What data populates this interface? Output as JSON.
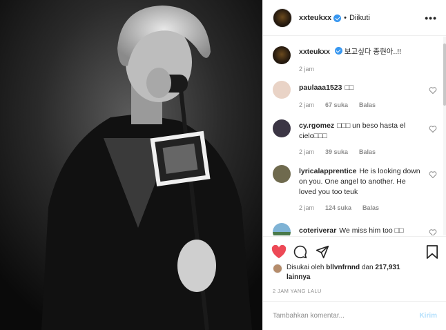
{
  "header": {
    "username": "xxteukxx",
    "dot": "•",
    "follow_label": "Diikuti",
    "more_label": "•••"
  },
  "caption": {
    "username": "xxteukxx",
    "text": "보고싶다 종현아..!!",
    "time": "2 jam"
  },
  "comments": [
    {
      "username": "paulaaa1523",
      "text": "□□",
      "time": "2 jam",
      "likes": "67 suka",
      "reply": "Balas"
    },
    {
      "username": "cy.rgomez",
      "text": "□□□ un beso hasta el cielo□□□",
      "time": "2 jam",
      "likes": "39 suka",
      "reply": "Balas"
    },
    {
      "username": "lyricalapprentice",
      "text": "He is looking down on you. One angel to another. He loved you too teuk",
      "time": "2 jam",
      "likes": "124 suka",
      "reply": "Balas"
    },
    {
      "username": "coteriverar",
      "text": "We miss him too □□"
    }
  ],
  "likes": {
    "prefix": "Disukai oleh",
    "user": "bllvnfrnnd",
    "and": "dan",
    "count": "217,931 lainnya"
  },
  "timestamp": "2 JAM YANG LALU",
  "add_comment": {
    "placeholder": "Tambahkan komentar...",
    "post_label": "Kirim"
  },
  "colors": {
    "like_red": "#ed4956",
    "verified_blue": "#3897f0"
  },
  "icons": [
    "heart-icon",
    "comment-icon",
    "share-icon",
    "bookmark-icon",
    "verified-icon"
  ]
}
